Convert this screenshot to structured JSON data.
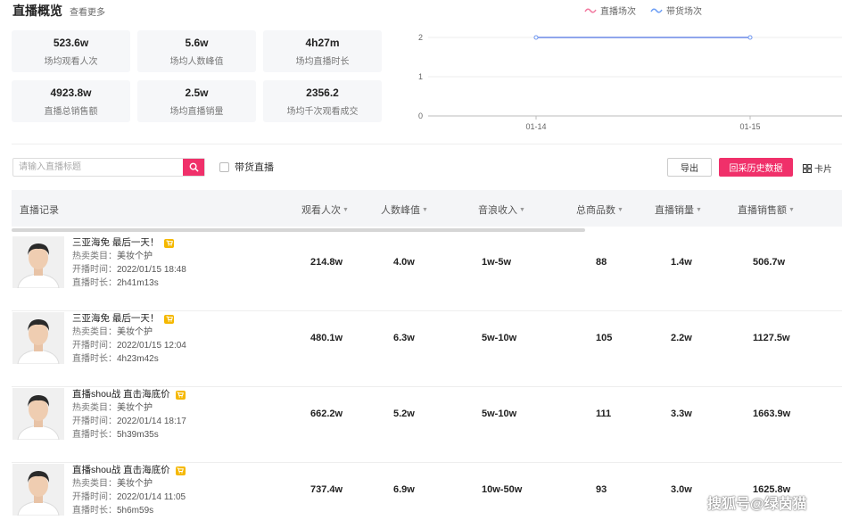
{
  "header": {
    "title": "直播概览",
    "more": "查看更多"
  },
  "stats": [
    {
      "value": "523.6w",
      "label": "场均观看人次"
    },
    {
      "value": "5.6w",
      "label": "场均人数峰值"
    },
    {
      "value": "4h27m",
      "label": "场均直播时长"
    },
    {
      "value": "4923.8w",
      "label": "直播总销售额"
    },
    {
      "value": "2.5w",
      "label": "场均直播销量"
    },
    {
      "value": "2356.2",
      "label": "场均千次观看成交"
    }
  ],
  "legend": [
    {
      "label": "直播场次",
      "color": "#f27aa0"
    },
    {
      "label": "带货场次",
      "color": "#6e9ff5"
    }
  ],
  "chart_data": {
    "type": "line",
    "x": [
      "01-14",
      "01-15"
    ],
    "yticks": [
      0,
      1,
      2
    ],
    "ylim": [
      0,
      2
    ],
    "series": [
      {
        "name": "直播场次",
        "values": [
          2,
          2
        ],
        "color": "#f27aa0"
      },
      {
        "name": "带货场次",
        "values": [
          2,
          2
        ],
        "color": "#6e9ff5"
      }
    ]
  },
  "toolbar": {
    "search_placeholder": "请输入直播标题",
    "checkbox_label": "带货直播",
    "export_label": "导出",
    "history_label": "回采历史数据",
    "card_label": "卡片"
  },
  "table": {
    "headers": [
      "直播记录",
      "观看人次",
      "人数峰值",
      "音浪收入",
      "总商品数",
      "直播销量",
      "直播销售额"
    ],
    "meta_labels": {
      "category": "热卖类目：",
      "start": "开播时间：",
      "duration": "直播时长："
    },
    "rows": [
      {
        "title": "三亚海免 最后一天！",
        "category": "美妆个护",
        "start": "2022/01/15 18:48",
        "duration": "2h41m13s",
        "views": "214.8w",
        "peak": "4.0w",
        "income": "1w-5w",
        "products": "88",
        "sales": "1.4w",
        "revenue": "506.7w"
      },
      {
        "title": "三亚海免 最后一天！",
        "category": "美妆个护",
        "start": "2022/01/15 12:04",
        "duration": "4h23m42s",
        "views": "480.1w",
        "peak": "6.3w",
        "income": "5w-10w",
        "products": "105",
        "sales": "2.2w",
        "revenue": "1127.5w"
      },
      {
        "title": "直播shou战 直击海底价",
        "category": "美妆个护",
        "start": "2022/01/14 18:17",
        "duration": "5h39m35s",
        "views": "662.2w",
        "peak": "5.2w",
        "income": "5w-10w",
        "products": "111",
        "sales": "3.3w",
        "revenue": "1663.9w"
      },
      {
        "title": "直播shou战 直击海底价",
        "category": "美妆个护",
        "start": "2022/01/14 11:05",
        "duration": "5h6m59s",
        "views": "737.4w",
        "peak": "6.9w",
        "income": "10w-50w",
        "products": "93",
        "sales": "3.0w",
        "revenue": "1625.8w"
      }
    ]
  },
  "watermark": "搜狐号@绿茵猫"
}
